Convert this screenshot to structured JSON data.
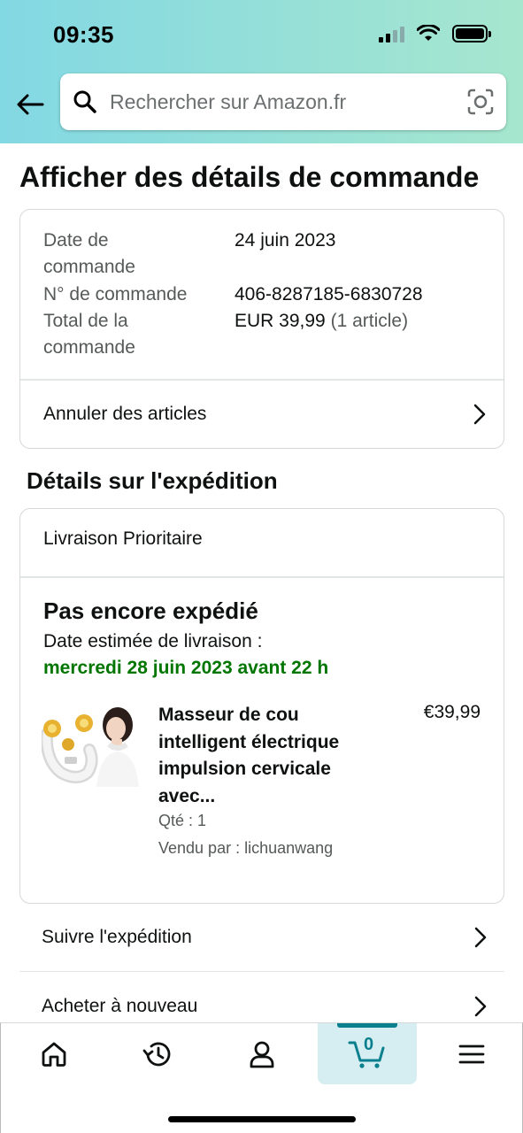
{
  "status_bar": {
    "time": "09:35"
  },
  "search": {
    "placeholder": "Rechercher sur Amazon.fr"
  },
  "page": {
    "title": "Afficher des détails de commande"
  },
  "order_summary": {
    "date_label": [
      "Date de",
      "commande"
    ],
    "date_value": "24 juin 2023",
    "number_label": "N° de commande",
    "number_value": "406-8287185-6830728",
    "total_label": [
      "Total de la",
      "commande"
    ],
    "total_value": "EUR 39,99",
    "total_items": "(1 article)",
    "cancel_label": "Annuler des articles"
  },
  "shipping": {
    "section_title": "Détails sur l'expédition",
    "type": "Livraison Prioritaire",
    "status": "Pas encore expédié",
    "estimated_label": "Date estimée de livraison :",
    "estimated_date": "mercredi 28 juin 2023 avant 22 h",
    "product": {
      "title_lines": [
        "Masseur de cou",
        "intelligent électrique",
        "impulsion cervicale",
        "avec..."
      ],
      "price": "€39,99",
      "quantity": "Qté : 1",
      "seller": "Vendu par : lichuanwang"
    }
  },
  "links": {
    "track": "Suivre l'expédition",
    "buy_again": "Acheter à nouveau"
  },
  "bottom_nav": {
    "items": [
      {
        "name": "home",
        "icon": "home-icon"
      },
      {
        "name": "history",
        "icon": "history-icon"
      },
      {
        "name": "account",
        "icon": "account-icon"
      },
      {
        "name": "cart",
        "icon": "cart-icon",
        "count": "0",
        "active": true
      },
      {
        "name": "menu",
        "icon": "menu-icon"
      }
    ]
  },
  "colors": {
    "header_gradient_start": "#82d8e3",
    "header_gradient_end": "#a6e6ce",
    "delivery_green": "#007600",
    "cart_accent": "#0a7f8e"
  }
}
